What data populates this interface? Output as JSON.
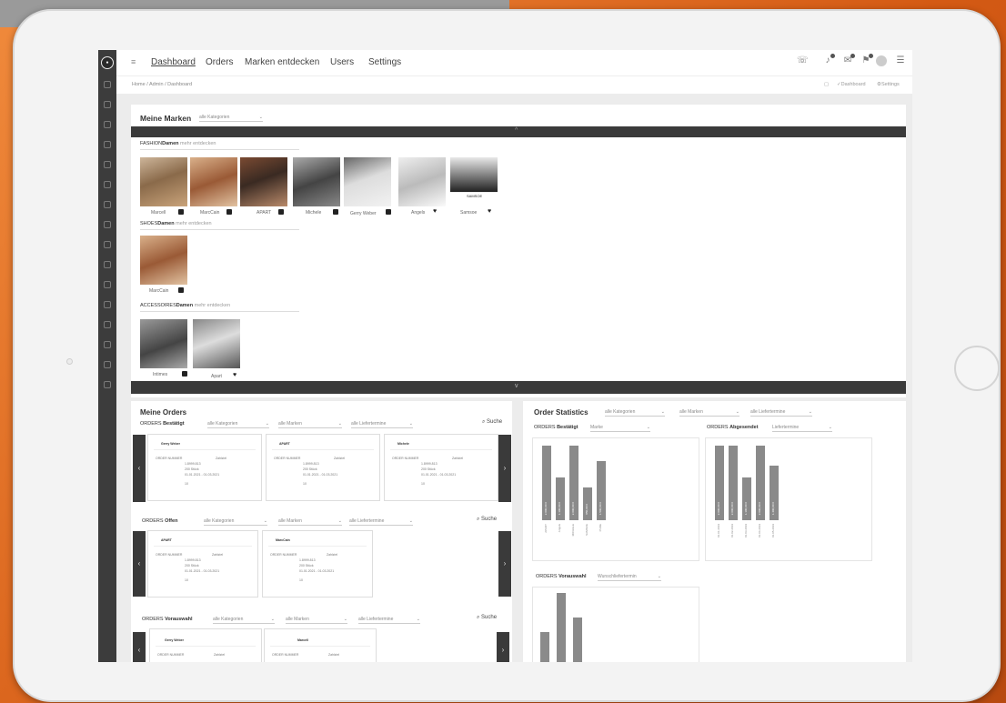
{
  "nav": {
    "items": [
      "Dashboard",
      "Orders",
      "Marken entdecken",
      "Users",
      "Settings"
    ]
  },
  "breadcrumb": {
    "path": "Home / Admin / Dashboard",
    "right_dashboard": "Dashboard",
    "right_settings": "Settings"
  },
  "marken": {
    "title": "Meine Marken",
    "filter": "alle Kategorien",
    "categories": [
      {
        "prefix": "FASHION",
        "bold": "Damen",
        "more": "mehr entdecken",
        "items": [
          {
            "name": "Marcell",
            "badge": "lock"
          },
          {
            "name": "MarcCain",
            "badge": "lock"
          },
          {
            "name": "APART",
            "badge": "lock"
          },
          {
            "name": "Michele",
            "badge": "lock"
          },
          {
            "name": "Gerry Weber",
            "badge": "lock"
          },
          {
            "name": "Angels",
            "badge": "heart"
          },
          {
            "name": "Samsoe",
            "badge": "heart"
          }
        ]
      },
      {
        "prefix": "SHOES",
        "bold": "Damen",
        "more": "mehr entdecken",
        "items": [
          {
            "name": "MarcCain",
            "badge": "lock"
          }
        ]
      },
      {
        "prefix": "ACCESSOIRES",
        "bold": "Damen",
        "more": "mehr entdecken",
        "items": [
          {
            "name": "Intimes",
            "badge": "lock"
          },
          {
            "name": "Apart",
            "badge": "heart"
          }
        ]
      }
    ],
    "tile_overlay_text": "SAMSOE"
  },
  "orders": {
    "title": "Meine Orders",
    "search_label": "Suche",
    "filters": [
      "alle Kategorien",
      "alle Marken",
      "alle Liefertermine"
    ],
    "groups": [
      {
        "prefix": "ORDERS",
        "bold": "Bestätigt",
        "cards": [
          "Gerry Weber",
          "APART",
          "Michele"
        ]
      },
      {
        "prefix": "ORDERS",
        "bold": "Offen",
        "cards": [
          "APART",
          "MarcCain"
        ]
      },
      {
        "prefix": "ORDERS",
        "bold": "Vorauswahl",
        "cards": [
          "Gerry Weber",
          "Marcell"
        ]
      }
    ],
    "card_fields": {
      "order_number_label": "ORDER NUMMER",
      "order_number": "1.8999.813",
      "quantity": "200 Stück",
      "delivery": "01.01.2021 - 01.03.2021",
      "status_label": "Zahlziel",
      "extra": "10"
    }
  },
  "stats": {
    "title": "Order Statistics",
    "filters": [
      "alle Kategorien",
      "alle Marken",
      "alle Liefertermine"
    ],
    "panels": [
      {
        "prefix": "ORDERS",
        "bold": "Bestätigt",
        "filter": "Marke"
      },
      {
        "prefix": "ORDERS",
        "bold": "Abgesendet",
        "filter": "Liefertermine"
      },
      {
        "prefix": "ORDERS",
        "bold": "Vorauswahl",
        "filter": "Wunschliefertermin"
      }
    ]
  },
  "chart_data": [
    {
      "type": "bar",
      "categories": [
        "APART",
        "Angels",
        "MICHELE",
        "SAMSOE",
        "PURE"
      ],
      "values": [
        95,
        55,
        95,
        42,
        75
      ],
      "bar_labels": [
        "2.000,00 €",
        "1.100,00 €",
        "2.000,00 €",
        "850,00 €",
        "1.500,00 €"
      ],
      "ylim": [
        0,
        100
      ]
    },
    {
      "type": "bar",
      "categories": [
        "01.01.2019",
        "01.02.2019",
        "01.03.2019",
        "01.04.2019",
        "01.05.2019"
      ],
      "values": [
        95,
        95,
        55,
        95,
        70
      ],
      "bar_labels": [
        "2.000,00 €",
        "2.000,00 €",
        "1.100,00 €",
        "2.000,00 €",
        "1.400,00 €"
      ],
      "ylim": [
        0,
        100
      ]
    },
    {
      "type": "bar",
      "categories": [
        "",
        "",
        ""
      ],
      "values": [
        45,
        100,
        65
      ],
      "ylim": [
        0,
        100
      ]
    }
  ],
  "colors": {
    "sidebar": "#3c3c3c",
    "accent_bar": "#3a3a3a",
    "bar_fill": "#8a8a8a"
  }
}
